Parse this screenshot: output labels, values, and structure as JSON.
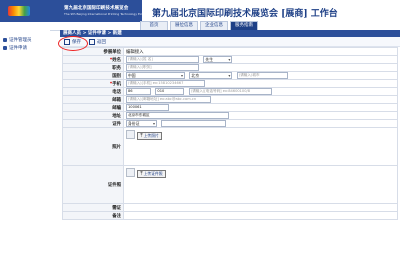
{
  "header": {
    "logo_cn": "第九届北京国际印刷技术展览会",
    "logo_en": "The 9th Beijing International Printing Technology Exhibition",
    "title": "第九届北京国际印刷技术展览会 [展商] 工作台",
    "tabs": [
      {
        "label": "首页"
      },
      {
        "label": "展位信息"
      },
      {
        "label": "企业信息"
      },
      {
        "label": "服务指南"
      }
    ]
  },
  "sidebar": {
    "items": [
      {
        "label": "证件管理员",
        "icon": "card-icon"
      },
      {
        "label": "证件申请",
        "icon": "document-icon"
      }
    ]
  },
  "breadcrumb": "展商人员 > 证件申请 > 新建",
  "toolbar": {
    "save_label": "保存",
    "back_label": "返回"
  },
  "form": {
    "exhibitor": {
      "label": "参展单位",
      "value": "编辑接入"
    },
    "name": {
      "label": "姓名",
      "placeholder": "(请输入)[姓 名]",
      "gender": "先生"
    },
    "position": {
      "label": "职务",
      "placeholder": "(请输入)[职务]"
    },
    "country": {
      "label": "国别",
      "country": "中国",
      "province": "北京",
      "city_placeholder": "(请输入)城市"
    },
    "mobile": {
      "label": "手机",
      "placeholder": "(请输入)[手机] ex:15810234667"
    },
    "phone": {
      "label": "电话",
      "code1": "86",
      "code2": "010",
      "number_placeholder": "(请输入)[电话号码] ex:84600100/8"
    },
    "email": {
      "label": "邮箱",
      "placeholder": "(请输入)[邮箱地址] ex:abc@abc.com.cn"
    },
    "zip": {
      "label": "邮编",
      "value": "100061"
    },
    "address": {
      "label": "地址",
      "value": "北京市东城区"
    },
    "id_doc": {
      "label": "证件",
      "type": "身份证",
      "placeholder": ""
    },
    "photo": {
      "label": "照片",
      "button": "上传照片"
    },
    "id_photo": {
      "label": "证件照",
      "button": "上传证件照"
    },
    "remark": {
      "label": "需证",
      "value": ""
    },
    "note": {
      "label": "备注",
      "value": ""
    }
  },
  "colors": {
    "brand": "#2c4f9a",
    "title": "#1d3f86",
    "highlight": "#ee2222"
  }
}
